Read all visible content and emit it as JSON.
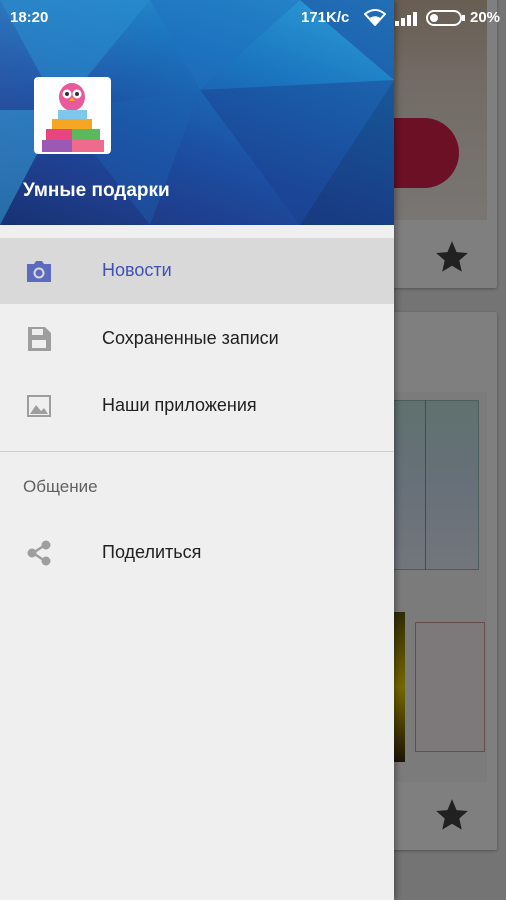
{
  "status_bar": {
    "time": "18:20",
    "speed": "171K/c",
    "battery": "20%",
    "icons": [
      "wifi-icon",
      "signal-icon",
      "battery-icon"
    ]
  },
  "drawer": {
    "app_name": "Умные подарки",
    "logo": "owl-gifts-logo",
    "menu": [
      {
        "label": "Новости",
        "icon": "camera-icon",
        "selected": true
      },
      {
        "label": "Сохраненные записи",
        "icon": "save-icon",
        "selected": false
      },
      {
        "label": "Наши приложения",
        "icon": "image-icon",
        "selected": false
      }
    ],
    "section_title": "Общение",
    "section_items": [
      {
        "label": "Поделиться",
        "icon": "share-icon"
      }
    ]
  },
  "colors": {
    "accent": "#3f51b5",
    "header_blue": "#1c4fa3",
    "selected_bg": "#d9d9d9",
    "drawer_bg": "#efefef"
  }
}
